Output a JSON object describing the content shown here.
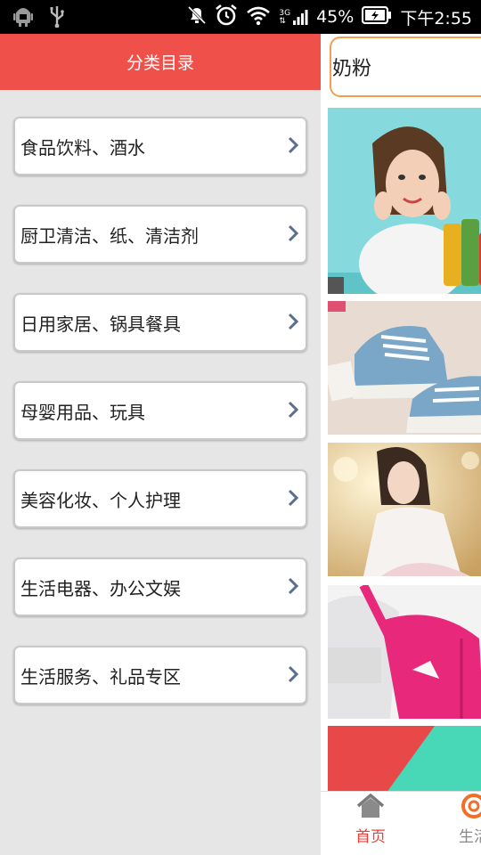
{
  "status_bar": {
    "battery": "45%",
    "time": "下午2:55",
    "network": "3G"
  },
  "drawer": {
    "title": "分类目录",
    "categories": [
      {
        "label": "食品饮料、酒水"
      },
      {
        "label": "厨卫清洁、纸、清洁剂"
      },
      {
        "label": "日用家居、锅具餐具"
      },
      {
        "label": "母婴用品、玩具"
      },
      {
        "label": "美容化妆、个人护理"
      },
      {
        "label": "生活电器、办公文娱"
      },
      {
        "label": "生活服务、礼品专区"
      }
    ]
  },
  "search": {
    "value": "奶粉"
  },
  "tabbar": {
    "tabs": [
      {
        "label": "首页",
        "active": true
      },
      {
        "label": "生活",
        "active": false
      }
    ]
  },
  "colors": {
    "header_red": "#f0504a",
    "search_border": "#f0a050",
    "tab_active": "#e8403a",
    "chevron": "#5a6f8f"
  }
}
